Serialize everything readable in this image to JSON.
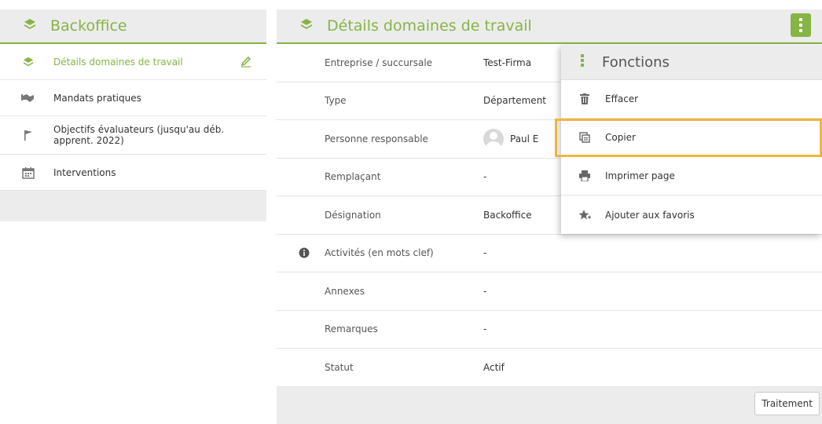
{
  "left_panel": {
    "title": "Backoffice",
    "items": [
      {
        "label": "Détails domaines de travail",
        "icon": "layers-icon",
        "active": true
      },
      {
        "label": "Mandats pratiques",
        "icon": "handshake-icon"
      },
      {
        "label": "Objectifs évaluateurs (jusqu'au déb. apprent. 2022)",
        "icon": "flag-icon"
      },
      {
        "label": "Interventions",
        "icon": "calendar-icon"
      }
    ]
  },
  "right_panel": {
    "title": "Détails domaines de travail",
    "rows": [
      {
        "label": "Entreprise / succursale",
        "value": "Test-Firma"
      },
      {
        "label": "Type",
        "value": "Département"
      },
      {
        "label": "Personne responsable",
        "value": "Paul E"
      },
      {
        "label": "Remplaçant",
        "value": "-"
      },
      {
        "label": "Désignation",
        "value": "Backoffice"
      },
      {
        "label": "Activités (en mots clef)",
        "value": "-"
      },
      {
        "label": "Annexes",
        "value": "-"
      },
      {
        "label": "Remarques",
        "value": "-"
      },
      {
        "label": "Statut",
        "value": "Actif"
      }
    ],
    "footer_button": "Traitement"
  },
  "functions_menu": {
    "title": "Fonctions",
    "items": [
      {
        "label": "Effacer",
        "icon": "trash-icon"
      },
      {
        "label": "Copier",
        "icon": "copy-icon",
        "highlighted": true
      },
      {
        "label": "Imprimer page",
        "icon": "print-icon"
      },
      {
        "label": "Ajouter aux favoris",
        "icon": "star-plus-icon"
      }
    ]
  },
  "colors": {
    "accent": "#86b545",
    "highlight": "#f0b63a",
    "panel_bg": "#ececec"
  }
}
